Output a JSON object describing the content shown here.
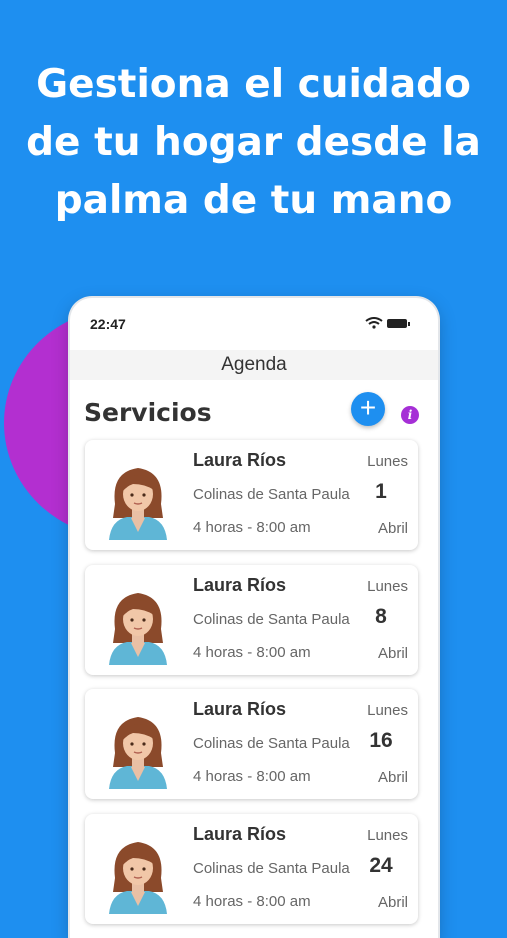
{
  "headline": {
    "line1": "Gestiona el cuidado",
    "line2": "de tu hogar desde la",
    "line3": "palma de tu mano"
  },
  "status_bar": {
    "time": "22:47"
  },
  "appbar": {
    "title": "Agenda"
  },
  "section": {
    "title": "Servicios",
    "add_icon": "plus-icon",
    "info_icon": "info-icon",
    "info_symbol": "i",
    "add_symbol": "+"
  },
  "services": [
    {
      "name": "Laura Ríos",
      "address": "Colinas de Santa Paula",
      "hours": "4 horas - 8:00 am",
      "day_name": "Lunes",
      "day": "1",
      "month": "Abril"
    },
    {
      "name": "Laura Ríos",
      "address": "Colinas de Santa Paula",
      "hours": "4 horas - 8:00 am",
      "day_name": "Lunes",
      "day": "8",
      "month": "Abril"
    },
    {
      "name": "Laura Ríos",
      "address": "Colinas de Santa Paula",
      "hours": "4 horas - 8:00 am",
      "day_name": "Lunes",
      "day": "16",
      "month": "Abril"
    },
    {
      "name": "Laura Ríos",
      "address": "Colinas de Santa Paula",
      "hours": "4 horas - 8:00 am",
      "day_name": "Lunes",
      "day": "24",
      "month": "Abril"
    }
  ],
  "colors": {
    "background": "#1e8ff0",
    "accent_purple": "#b32fd0",
    "button_blue": "#1e8ff0"
  }
}
